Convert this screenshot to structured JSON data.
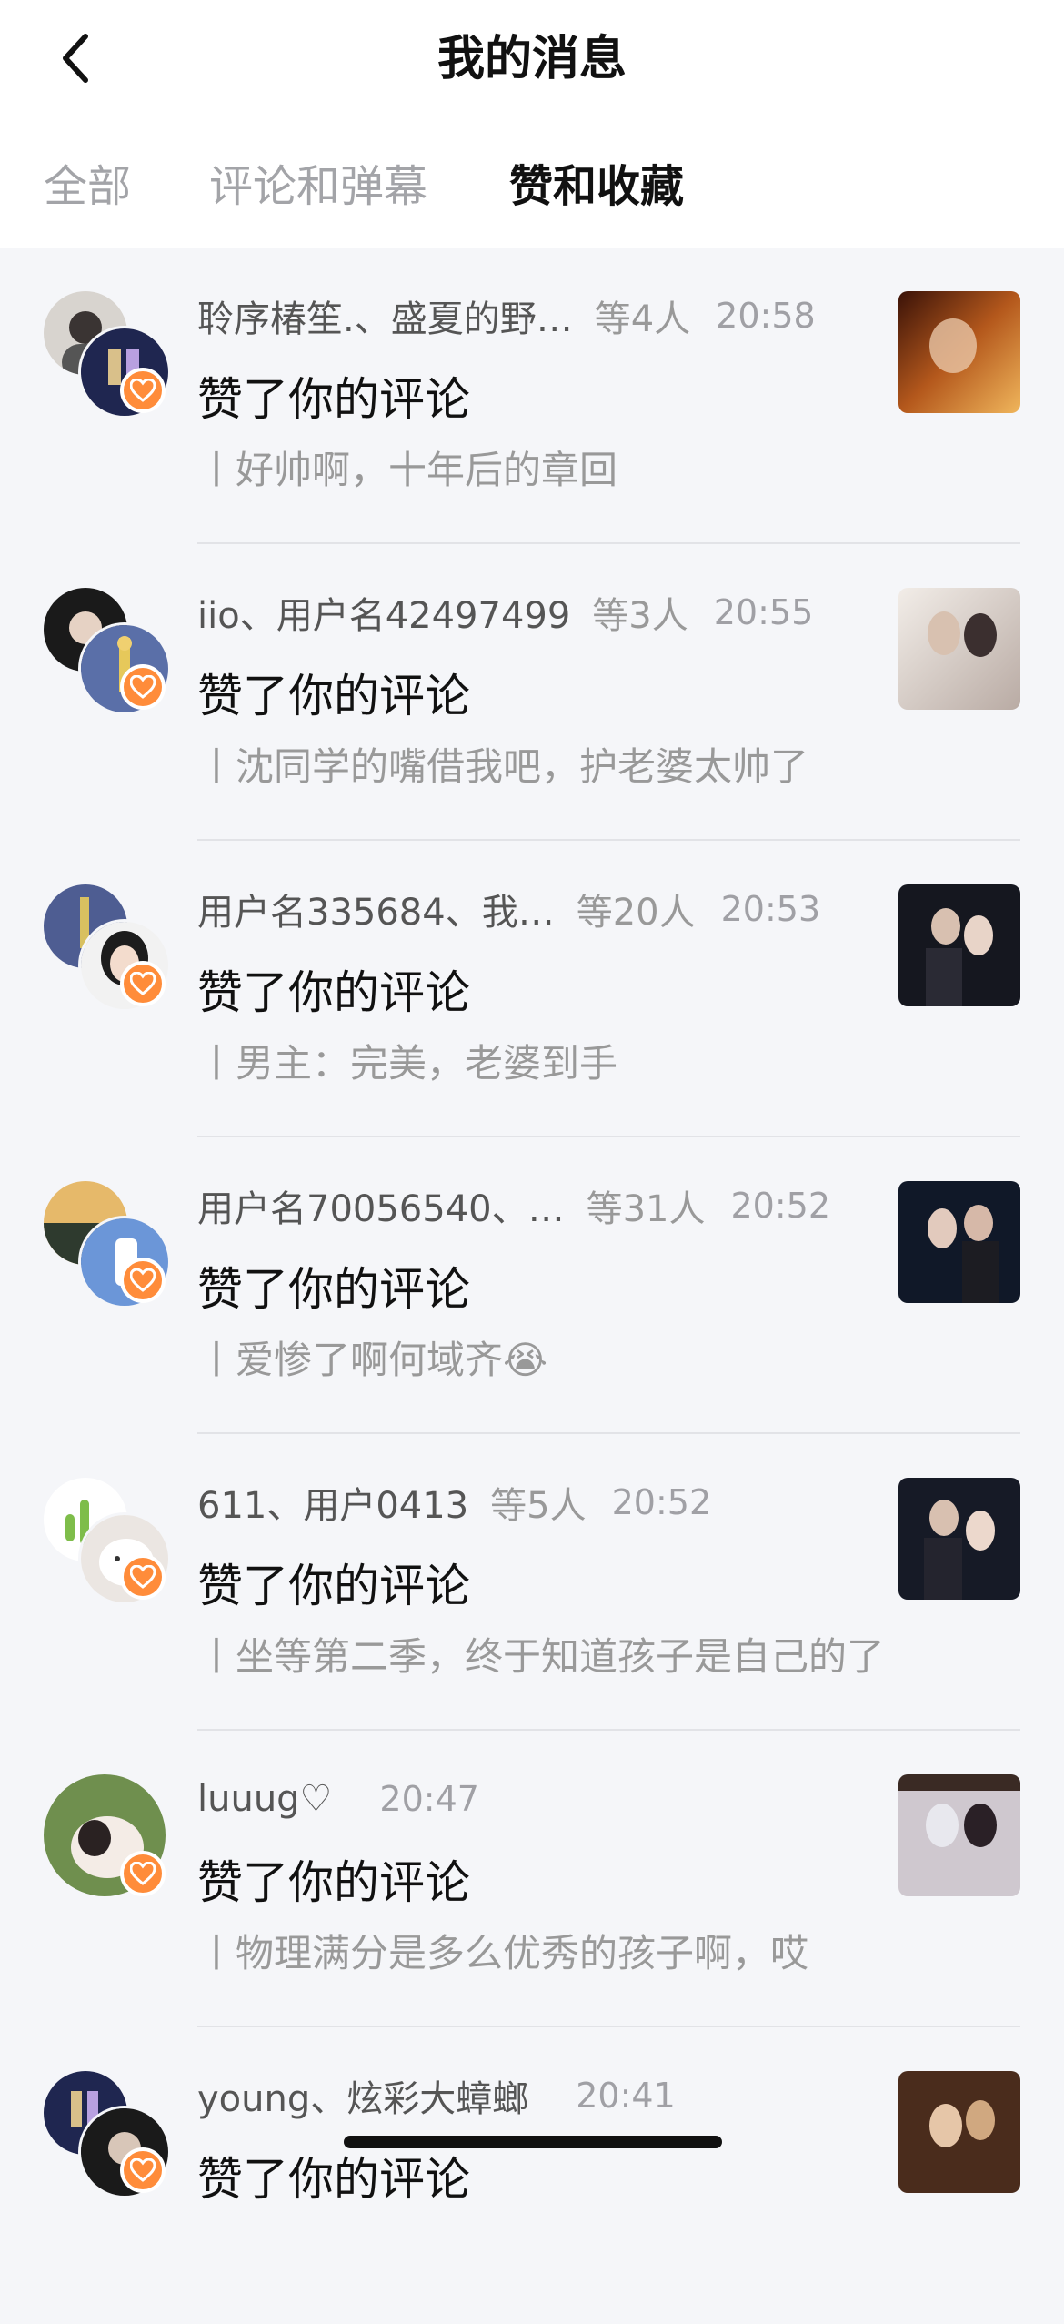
{
  "header": {
    "title": "我的消息",
    "back_icon": "chevron-left-icon",
    "tabs": [
      {
        "label": "全部",
        "active": false
      },
      {
        "label": "评论和弹幕",
        "active": false
      },
      {
        "label": "赞和收藏",
        "active": true
      }
    ]
  },
  "colors": {
    "accent_badge": "#ff8c3a",
    "background": "#f5f6f9",
    "header_bg": "#ffffff",
    "muted_text": "#a3a4a8"
  },
  "notifications": [
    {
      "names": "聆序椿笙.、盛夏的野…",
      "others": "等4人",
      "time": "20:58",
      "action": "赞了你的评论",
      "quote": "丨好帅啊，十年后的章回",
      "badge_icon": "heart-icon"
    },
    {
      "names": "iio、用户名42497499",
      "others": "等3人",
      "time": "20:55",
      "action": "赞了你的评论",
      "quote": "丨沈同学的嘴借我吧，护老婆太帅了",
      "badge_icon": "heart-icon"
    },
    {
      "names": "用户名335684、我…",
      "others": "等20人",
      "time": "20:53",
      "action": "赞了你的评论",
      "quote": "丨男主：完美，老婆到手",
      "badge_icon": "heart-icon"
    },
    {
      "names": "用户名70056540、…",
      "others": "等31人",
      "time": "20:52",
      "action": "赞了你的评论",
      "quote": "丨爱惨了啊何域齐😭",
      "badge_icon": "heart-icon"
    },
    {
      "names": "611、用户0413",
      "others": "等5人",
      "time": "20:52",
      "action": "赞了你的评论",
      "quote": "丨坐等第二季，终于知道孩子是自己的了",
      "badge_icon": "heart-icon"
    },
    {
      "names": "luuug♡",
      "others": "",
      "time": "20:47",
      "action": "赞了你的评论",
      "quote": "丨物理满分是多么优秀的孩子啊，哎",
      "badge_icon": "heart-icon"
    },
    {
      "names": "young、炫彩大蟑螂",
      "others": "",
      "time": "20:41",
      "action": "赞了你的评论",
      "quote": "",
      "badge_icon": "heart-icon"
    }
  ]
}
